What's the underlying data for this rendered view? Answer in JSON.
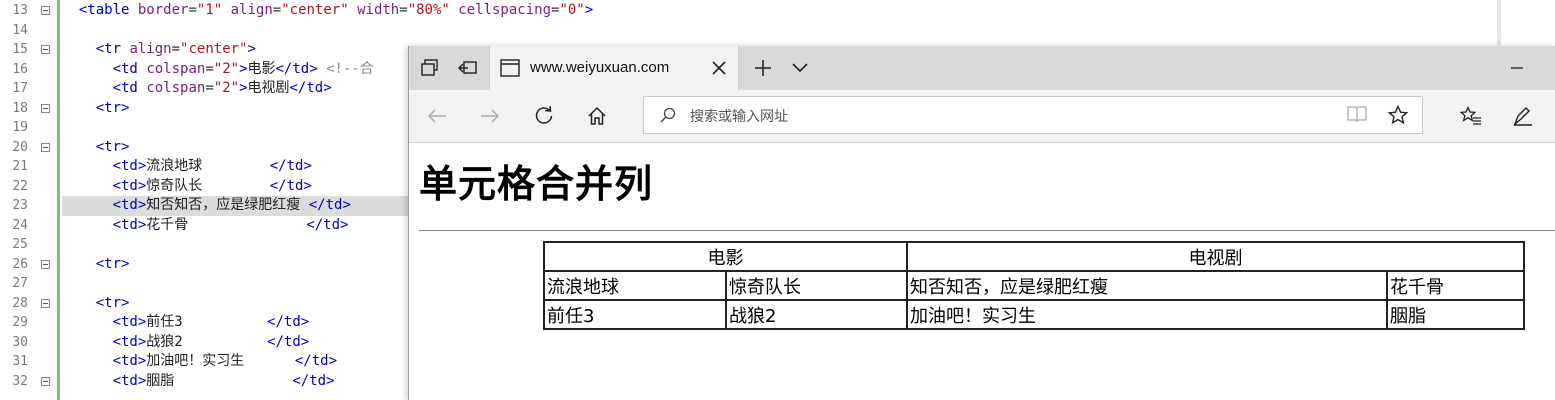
{
  "editor": {
    "lines": [
      {
        "n": "13",
        "fold": true,
        "html": "  <span class='tag'>&lt;table</span> <span class='attr'>border</span>=<span class='val'>\"1\"</span> <span class='attr'>align</span>=<span class='val'>\"center\"</span> <span class='attr'>width</span>=<span class='val'>\"80%\"</span> <span class='attr'>cellspacing</span>=<span class='val'>\"0\"</span><span class='tag'>&gt;</span>"
      },
      {
        "n": "14",
        "fold": false,
        "html": ""
      },
      {
        "n": "15",
        "fold": true,
        "html": "    <span class='tag'>&lt;tr</span> <span class='attr'>align</span>=<span class='val'>\"center\"</span><span class='tag'>&gt;</span>"
      },
      {
        "n": "16",
        "fold": false,
        "html": "      <span class='tag'>&lt;td</span> <span class='attr'>colspan</span>=<span class='val'>\"2\"</span><span class='tag'>&gt;</span><span class='txt'>电影</span><span class='tag'>&lt;/td&gt;</span> <span class='cmt'>&lt;!--合</span>"
      },
      {
        "n": "17",
        "fold": false,
        "html": "      <span class='tag'>&lt;td</span> <span class='attr'>colspan</span>=<span class='val'>\"2\"</span><span class='tag'>&gt;</span><span class='txt'>电视剧</span><span class='tag'>&lt;/td&gt;</span>"
      },
      {
        "n": "18",
        "fold": true,
        "html": "    <span class='tag'>&lt;tr&gt;</span>"
      },
      {
        "n": "19",
        "fold": false,
        "html": ""
      },
      {
        "n": "20",
        "fold": true,
        "html": "    <span class='tag'>&lt;tr&gt;</span>"
      },
      {
        "n": "21",
        "fold": false,
        "html": "      <span class='tag'>&lt;td&gt;</span><span class='txt'>流浪地球</span>        <span class='tag'>&lt;/td&gt;</span>"
      },
      {
        "n": "22",
        "fold": false,
        "html": "      <span class='tag'>&lt;td&gt;</span><span class='txt'>惊奇队长</span>        <span class='tag'>&lt;/td&gt;</span>"
      },
      {
        "n": "23",
        "fold": false,
        "hl": true,
        "html": "      <span class='tag'>&lt;td&gt;</span><span class='txt'>知否知否，应是绿肥红瘦</span> <span class='tag'>&lt;/td&gt;</span>"
      },
      {
        "n": "24",
        "fold": false,
        "html": "      <span class='tag'>&lt;td&gt;</span><span class='txt'>花千骨</span>              <span class='tag'>&lt;/td&gt;</span>"
      },
      {
        "n": "25",
        "fold": false,
        "html": ""
      },
      {
        "n": "26",
        "fold": true,
        "html": "    <span class='tag'>&lt;tr&gt;</span>"
      },
      {
        "n": "27",
        "fold": false,
        "html": ""
      },
      {
        "n": "28",
        "fold": true,
        "html": "    <span class='tag'>&lt;tr&gt;</span>"
      },
      {
        "n": "29",
        "fold": false,
        "html": "      <span class='tag'>&lt;td&gt;</span><span class='txt'>前任3</span>          <span class='tag'>&lt;/td&gt;</span>"
      },
      {
        "n": "30",
        "fold": false,
        "html": "      <span class='tag'>&lt;td&gt;</span><span class='txt'>战狼2</span>          <span class='tag'>&lt;/td&gt;</span>"
      },
      {
        "n": "31",
        "fold": false,
        "html": "      <span class='tag'>&lt;td&gt;</span><span class='txt'>加油吧！实习生</span>      <span class='tag'>&lt;/td&gt;</span>"
      },
      {
        "n": "32",
        "fold": true,
        "html": "      <span class='tag'>&lt;td&gt;</span><span class='txt'>胭脂</span>              <span class='tag'>&lt;/td&gt;</span>"
      }
    ]
  },
  "browser": {
    "tab_title": "www.weiyuxuan.com",
    "address_placeholder": "搜索或输入网址",
    "icons": [
      "tab-switch-icon",
      "set-aside-icon",
      "favicon-page-icon",
      "close-icon",
      "plus-icon",
      "chevron-down-icon",
      "minimize-icon",
      "back-arrow-icon",
      "forward-arrow-icon",
      "refresh-icon",
      "home-icon",
      "search-icon",
      "reading-view-icon",
      "star-icon",
      "favorites-icon",
      "pen-icon"
    ]
  },
  "page": {
    "heading": "单元格合并列",
    "table": {
      "header": [
        "电影",
        "电视剧"
      ],
      "rows": [
        [
          "流浪地球",
          "惊奇队长",
          "知否知否，应是绿肥红瘦",
          "花千骨"
        ],
        [
          "前任3",
          "战狼2",
          "加油吧！实习生",
          "胭脂"
        ]
      ]
    }
  }
}
